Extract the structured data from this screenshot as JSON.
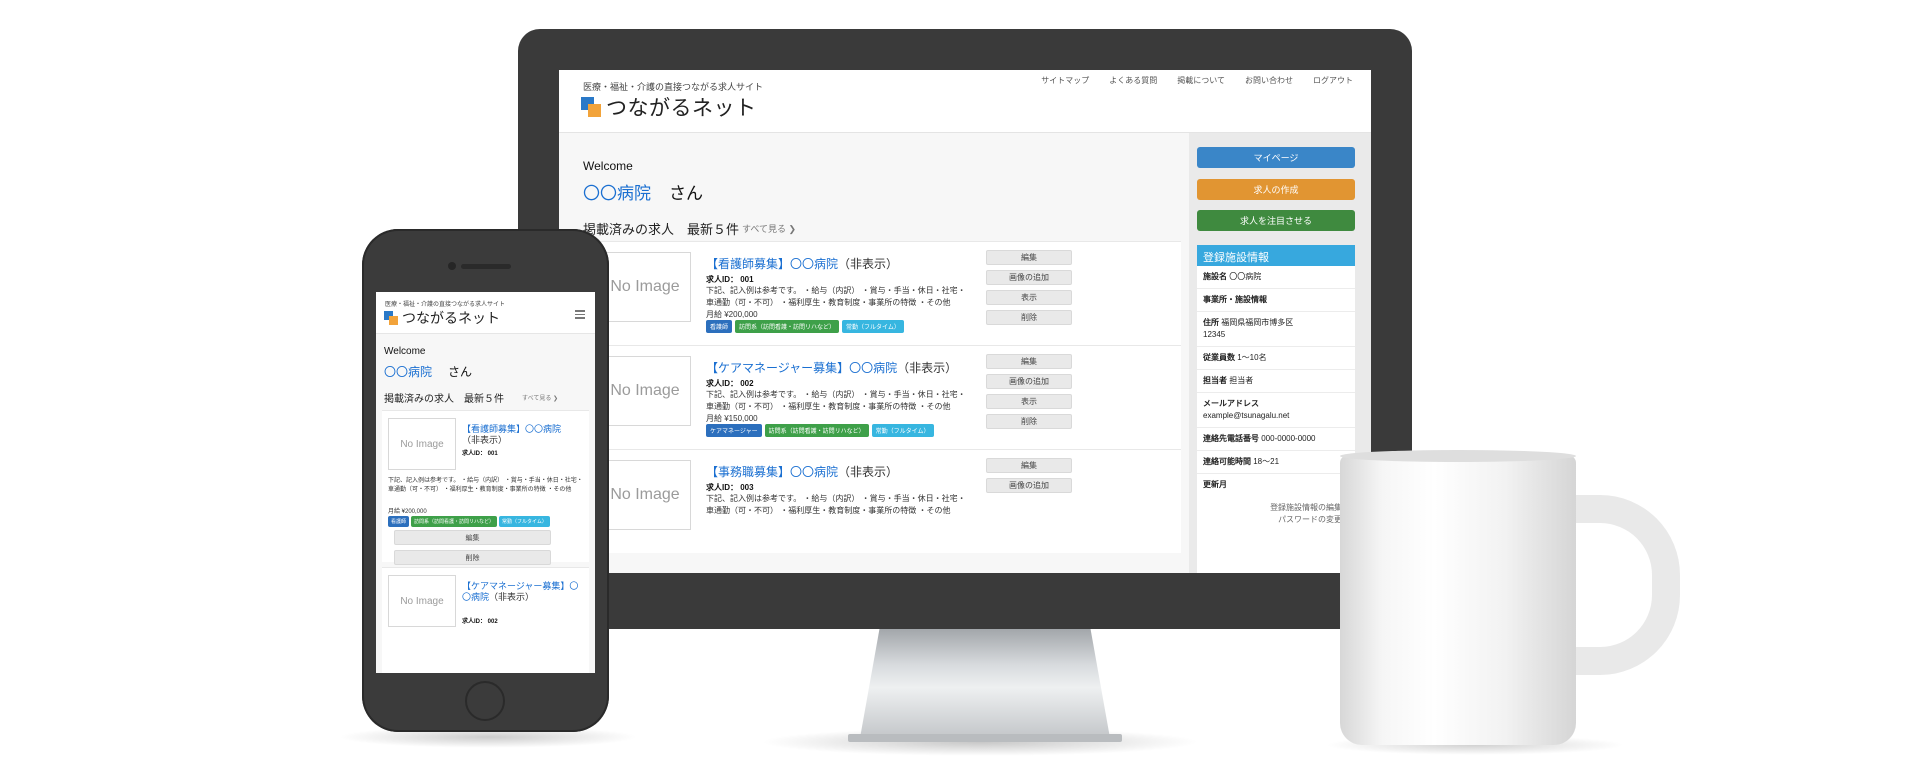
{
  "site": {
    "tagline": "医療・福祉・介護の直接つながる求人サイト",
    "logo_text": "つながるネット",
    "colors": {
      "accent_blue": "#1a6fd1",
      "logo_blue": "#2a79c8",
      "logo_orange": "#f2a33a"
    }
  },
  "desktop": {
    "nav": [
      "サイトマップ",
      "よくある質問",
      "掲載について",
      "お問い合わせ",
      "ログアウト"
    ],
    "welcome": "Welcome",
    "hospital_name": "〇〇病院",
    "san": "さん",
    "section_title": "掲載済みの求人　最新５件",
    "see_all": "すべて見る ❯",
    "jobs": [
      {
        "no_image": "No Image",
        "title_prefix": "【看護師募集】〇〇病院",
        "title_suffix": "（非表示）",
        "job_id": "求人ID： 001",
        "description": "下記、記入例は参考です。 ・給与（内訳） ・賞与・手当・休日・社宅・車通勤（可・不可） ・福利厚生・教育制度・事業所の特徴 ・その他",
        "salary": "月給 ¥200,000",
        "tags": [
          "看護師",
          "訪問系（訪問看護・訪問リハなど）",
          "常勤（フルタイム）"
        ],
        "buttons": [
          "編集",
          "画像の追加",
          "表示",
          "削除"
        ]
      },
      {
        "no_image": "No Image",
        "title_prefix": "【ケアマネージャー募集】〇〇病院",
        "title_suffix": "（非表示）",
        "job_id": "求人ID： 002",
        "description": "下記、記入例は参考です。 ・給与（内訳） ・賞与・手当・休日・社宅・車通勤（可・不可） ・福利厚生・教育制度・事業所の特徴 ・その他",
        "salary": "月給 ¥150,000",
        "tags": [
          "ケアマネージャー",
          "訪問系（訪問看護・訪問リハなど）",
          "常勤（フルタイム）"
        ],
        "buttons": [
          "編集",
          "画像の追加",
          "表示",
          "削除"
        ]
      },
      {
        "no_image": "No Image",
        "title_prefix": "【事務職募集】〇〇病院",
        "title_suffix": "（非表示）",
        "job_id": "求人ID： 003",
        "description": "下記、記入例は参考です。 ・給与（内訳） ・賞与・手当・休日・社宅・車通勤（可・不可） ・福利厚生・教育制度・事業所の特徴 ・その他",
        "buttons": [
          "編集",
          "画像の追加"
        ]
      }
    ],
    "sidebar": {
      "mypage": "マイページ",
      "create_job": "求人の作成",
      "feature_job": "求人を注目させる",
      "panel_title": "登録施設情報",
      "rows": [
        {
          "label": "施設名",
          "value": "〇〇病院"
        },
        {
          "label": "事業所・施設情報",
          "value": ""
        },
        {
          "label": "住所",
          "value": "福岡県福岡市博多区",
          "value2": "12345"
        },
        {
          "label": "従業員数",
          "value": "1〜10名"
        },
        {
          "label": "担当者",
          "value": "担当者"
        },
        {
          "label": "メールアドレス",
          "value2": "example@tsunagalu.net"
        },
        {
          "label": "連絡先電話番号",
          "value": "000-0000-0000"
        },
        {
          "label": "連絡可能時間",
          "value": "18〜21"
        },
        {
          "label": "更新月",
          "value": ""
        }
      ],
      "links": [
        "登録施設情報の編集 ❯",
        "パスワードの変更 ❯"
      ]
    }
  },
  "mobile": {
    "tagline": "医療・福祉・介護の直接つながる求人サイト",
    "logo_text": "つながるネット",
    "welcome": "Welcome",
    "hospital_name": "〇〇病院",
    "san": "さん",
    "section_title": "掲載済みの求人　最新５件",
    "see_all": "すべて見る ❯",
    "jobs": [
      {
        "no_image": "No Image",
        "title_prefix": "【看護師募集】〇〇病院",
        "title_suffix": "（非表示）",
        "job_id": "求人ID： 001",
        "description": "下記、記入例は参考です。 ・給与（内訳） ・賞与・手当・休日・社宅・車通勤（可・不可） ・福利厚生・教育制度・事業所の特徴 ・その他",
        "salary": "月給 ¥200,000",
        "tags": [
          "看護師",
          "訪問系（訪問看護・訪問リハなど）",
          "常勤（フルタイム）"
        ],
        "buttons": [
          "編集",
          "削除"
        ]
      },
      {
        "no_image": "No Image",
        "title_prefix": "【ケアマネージャー募集】〇〇病院",
        "title_suffix": "（非表示）",
        "job_id": "求人ID： 002"
      }
    ]
  }
}
